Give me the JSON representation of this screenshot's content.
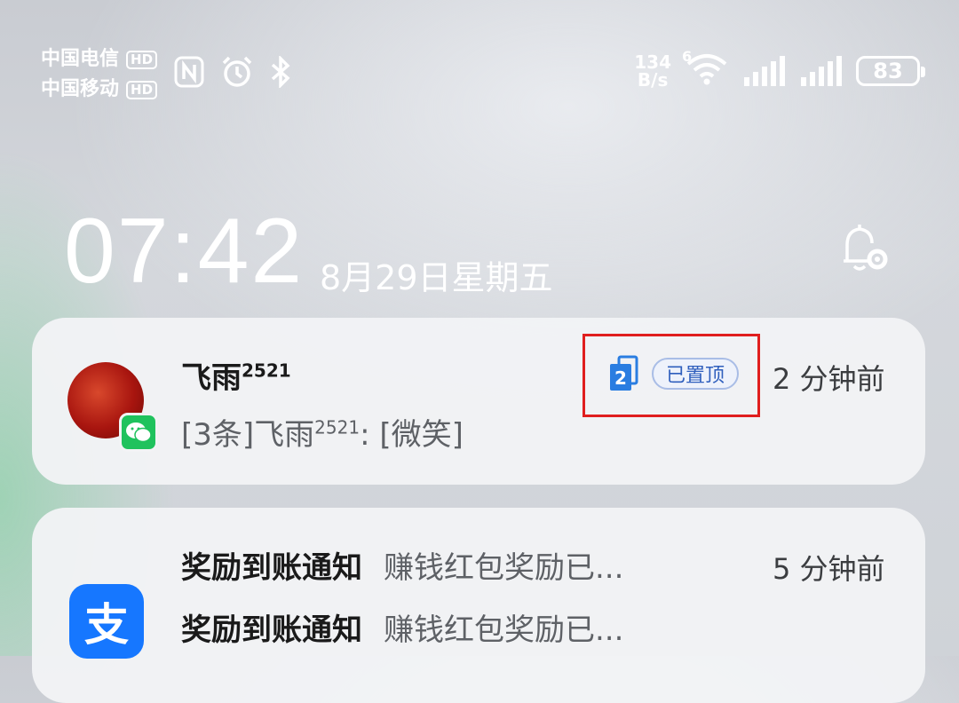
{
  "status_bar": {
    "carrier1": "中国电信",
    "carrier2": "中国移动",
    "hd_label": "HD",
    "speed_value": "134",
    "speed_unit": "B/s",
    "wifi_gen": "6",
    "battery": "83"
  },
  "lock": {
    "time": "07:42",
    "date": "8月29日星期五"
  },
  "notifications": [
    {
      "sender": "飞雨",
      "sender_sup": "2521",
      "preview_prefix": "[3条]飞雨",
      "preview_sup": "2521",
      "preview_suffix": ": [微笑]",
      "pin_count": "2",
      "pinned_label": "已置顶",
      "time": "2 分钟前"
    },
    {
      "app_icon_char": "支",
      "time": "5 分钟前",
      "rows": [
        {
          "title": "奖励到账通知",
          "body": "赚钱红包奖励已..."
        },
        {
          "title": "奖励到账通知",
          "body": "赚钱红包奖励已..."
        }
      ]
    }
  ],
  "colors": {
    "wechat": "#1fc25d",
    "alipay": "#1677ff",
    "pinned_tag": "#2f5fbd",
    "highlight": "#e01e1e"
  },
  "icons": [
    "nfc-icon",
    "alarm-icon",
    "bluetooth-icon",
    "wifi-icon",
    "signal-icon",
    "battery-icon",
    "bell-settings-icon",
    "wechat-icon",
    "alipay-icon",
    "pin-count-icon"
  ]
}
